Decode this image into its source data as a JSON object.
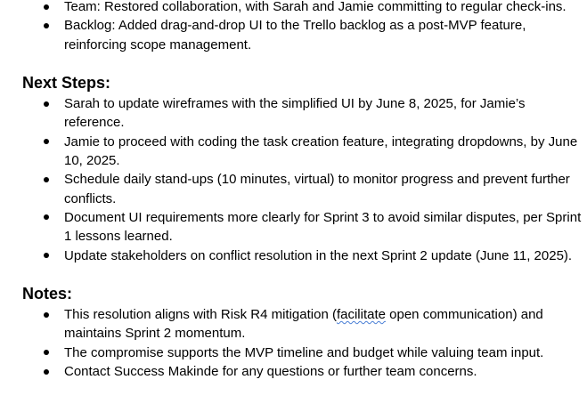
{
  "top_list": [
    "Team: Restored collaboration, with Sarah and Jamie committing to regular check-ins.",
    "Backlog: Added drag-and-drop UI to the Trello backlog as a post-MVP feature, reinforcing scope management."
  ],
  "next_steps": {
    "heading": "Next Steps:",
    "items": [
      "Sarah to update wireframes with the simplified UI by June 8, 2025, for Jamie’s reference.",
      "Jamie to proceed with coding the task creation feature, integrating dropdowns, by June 10, 2025.",
      "Schedule daily stand-ups (10 minutes, virtual) to monitor progress and prevent further conflicts.",
      "Document UI requirements more clearly for Sprint 3 to avoid similar disputes, per Sprint 1 lessons learned.",
      "Update stakeholders on conflict resolution in the next Sprint 2 update (June 11, 2025)."
    ]
  },
  "notes": {
    "heading": "Notes:",
    "first_item": {
      "before": "This resolution aligns with Risk R4 mitigation (",
      "flagged_word": "facilitate",
      "after": " open communication) and maintains Sprint 2 momentum."
    },
    "items": [
      "The compromise supports the MVP timeline and budget while valuing team input.",
      "Contact Success Makinde for any questions or further team concerns."
    ]
  },
  "colors": {
    "spellcheck_underline": "#4a7fd6"
  }
}
